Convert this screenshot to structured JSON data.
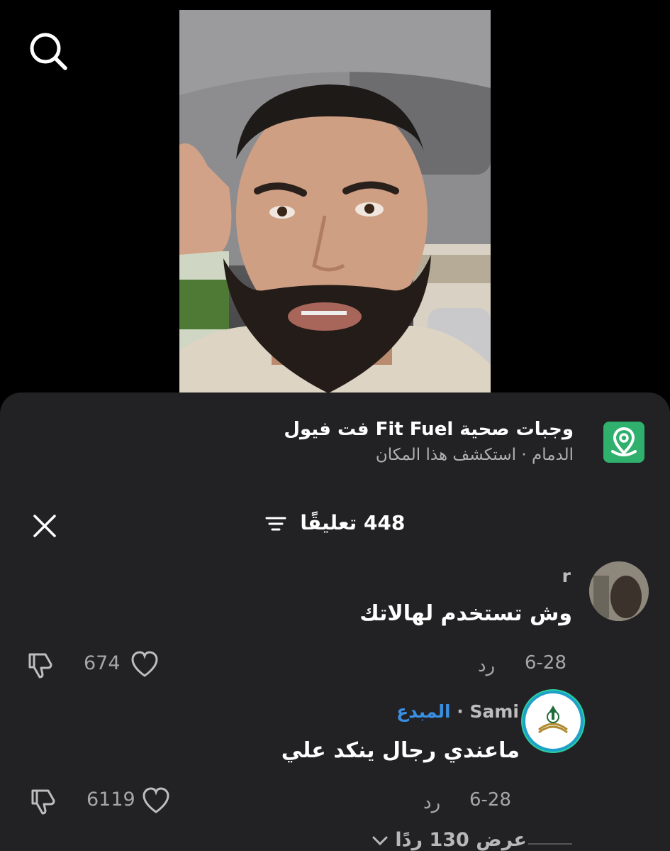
{
  "header": {
    "search_icon": "search-icon"
  },
  "place": {
    "title": "وجبات صحية Fit Fuel فت فيول",
    "subtitle": "الدمام · استكشف هذا المكان",
    "icon": "location-pin-icon",
    "icon_color": "#2fb06d"
  },
  "comments_header": {
    "count_label": "448 تعليقًا",
    "close_icon": "close-icon",
    "filter_icon": "filter-icon"
  },
  "comments": [
    {
      "username": "r",
      "text": "وش تستخدم لهالاتك",
      "date": "6-28",
      "reply_label": "رد",
      "likes": "674"
    },
    {
      "username": "Sami",
      "separator": "·",
      "badge": "المبدع",
      "text": "ماعندي رجال ينكد علي",
      "date": "6-28",
      "reply_label": "رد",
      "likes": "6119"
    }
  ],
  "view_replies": {
    "label": "عرض 130 ردًا"
  },
  "colors": {
    "sheet_bg": "#222224",
    "badge": "#3a8fe3",
    "accent_green": "#2fb06d"
  }
}
